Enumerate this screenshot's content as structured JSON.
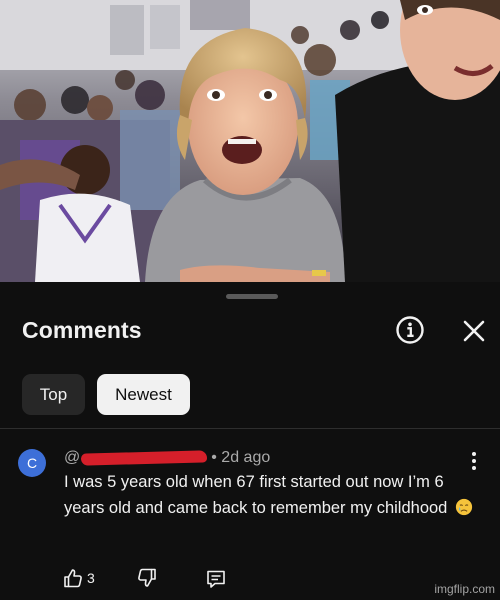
{
  "video": {
    "description_icon": "crowd-photo"
  },
  "panel": {
    "title": "Comments",
    "info_icon": "info-icon",
    "close_icon": "close-icon"
  },
  "filters": [
    {
      "label": "Top",
      "selected": false
    },
    {
      "label": "Newest",
      "selected": true
    }
  ],
  "comment": {
    "avatar_letter": "C",
    "avatar_color": "#3d6fd8",
    "handle_prefix": "@",
    "time": "• 2d ago",
    "text": "I was 5 years old when 67 first started out now I’m 6 years old and came back to remember my childhood",
    "likes": "3",
    "redaction_color": "#d51f2a"
  },
  "watermark": "imgflip.com"
}
